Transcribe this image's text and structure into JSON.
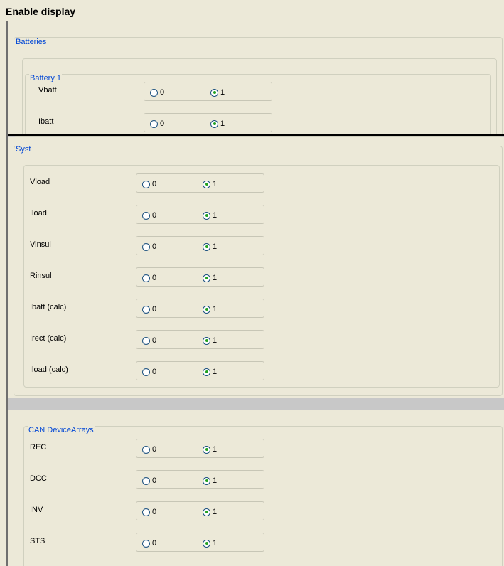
{
  "window": {
    "title": "Enable display"
  },
  "batteries": {
    "legend": "Batteries",
    "battery1": {
      "legend": "Battery 1",
      "rows": [
        {
          "label": "Vbatt",
          "opt0": "0",
          "opt1": "1",
          "selected": "1"
        },
        {
          "label": "Ibatt",
          "opt0": "0",
          "opt1": "1",
          "selected": "1"
        }
      ]
    }
  },
  "syst": {
    "legend": "Syst",
    "rows": [
      {
        "label": "Vload",
        "opt0": "0",
        "opt1": "1",
        "selected": "1"
      },
      {
        "label": "Iload",
        "opt0": "0",
        "opt1": "1",
        "selected": "1"
      },
      {
        "label": "Vinsul",
        "opt0": "0",
        "opt1": "1",
        "selected": "1"
      },
      {
        "label": "Rinsul",
        "opt0": "0",
        "opt1": "1",
        "selected": "1"
      },
      {
        "label": "Ibatt (calc)",
        "opt0": "0",
        "opt1": "1",
        "selected": "1"
      },
      {
        "label": "Irect (calc)",
        "opt0": "0",
        "opt1": "1",
        "selected": "1"
      },
      {
        "label": "Iload (calc)",
        "opt0": "0",
        "opt1": "1",
        "selected": "1"
      }
    ]
  },
  "can": {
    "legend": "CAN DeviceArrays",
    "rows": [
      {
        "label": "REC",
        "opt0": "0",
        "opt1": "1",
        "selected": "1"
      },
      {
        "label": "DCC",
        "opt0": "0",
        "opt1": "1",
        "selected": "1"
      },
      {
        "label": "INV",
        "opt0": "0",
        "opt1": "1",
        "selected": "1"
      },
      {
        "label": "STS",
        "opt0": "0",
        "opt1": "1",
        "selected": "1"
      }
    ]
  }
}
